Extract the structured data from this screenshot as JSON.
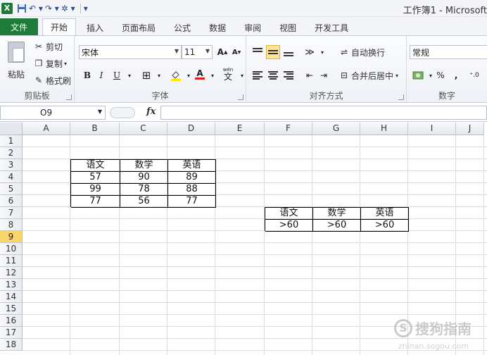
{
  "window": {
    "title": "工作簿1 - Microsoft"
  },
  "quick_access": {
    "logo": "X",
    "save_icon": "save-icon",
    "undo_icon": "undo-icon",
    "redo_icon": "redo-icon"
  },
  "tabs": [
    {
      "label": "文件"
    },
    {
      "label": "开始"
    },
    {
      "label": "插入"
    },
    {
      "label": "页面布局"
    },
    {
      "label": "公式"
    },
    {
      "label": "数据"
    },
    {
      "label": "审阅"
    },
    {
      "label": "视图"
    },
    {
      "label": "开发工具"
    }
  ],
  "ribbon": {
    "clipboard": {
      "label": "剪贴板",
      "paste": "粘贴",
      "cut": "剪切",
      "copy": "复制",
      "format_painter": "格式刷"
    },
    "font": {
      "label": "字体",
      "name": "宋体",
      "size": "11",
      "bold": "B",
      "italic": "I",
      "underline": "U",
      "grow": "A",
      "shrink": "A",
      "font_color_letter": "A",
      "phonetic": "wén"
    },
    "alignment": {
      "label": "对齐方式",
      "wrap": "自动换行",
      "merge": "合并后居中"
    },
    "number": {
      "label": "数字",
      "format": "常规",
      "percent": "%",
      "comma": ","
    }
  },
  "formula_bar": {
    "cell_ref": "O9",
    "fx": "fx",
    "value": ""
  },
  "grid": {
    "columns": [
      "A",
      "B",
      "C",
      "D",
      "E",
      "F",
      "G",
      "H",
      "I",
      "J"
    ],
    "rows": [
      "1",
      "2",
      "3",
      "4",
      "5",
      "6",
      "7",
      "8",
      "9",
      "10",
      "11",
      "12",
      "13",
      "14",
      "15",
      "16",
      "17",
      "18"
    ],
    "selected_row": "9"
  },
  "table1": {
    "headers": [
      "语文",
      "数学",
      "英语"
    ],
    "rows": [
      [
        "57",
        "90",
        "89"
      ],
      [
        "99",
        "78",
        "88"
      ],
      [
        "77",
        "56",
        "77"
      ]
    ]
  },
  "table2": {
    "headers": [
      "语文",
      "数学",
      "英语"
    ],
    "criteria": [
      ">60",
      ">60",
      ">60"
    ]
  },
  "watermark": {
    "text": "搜狗指南",
    "url": "zhinan.sogou.com"
  }
}
